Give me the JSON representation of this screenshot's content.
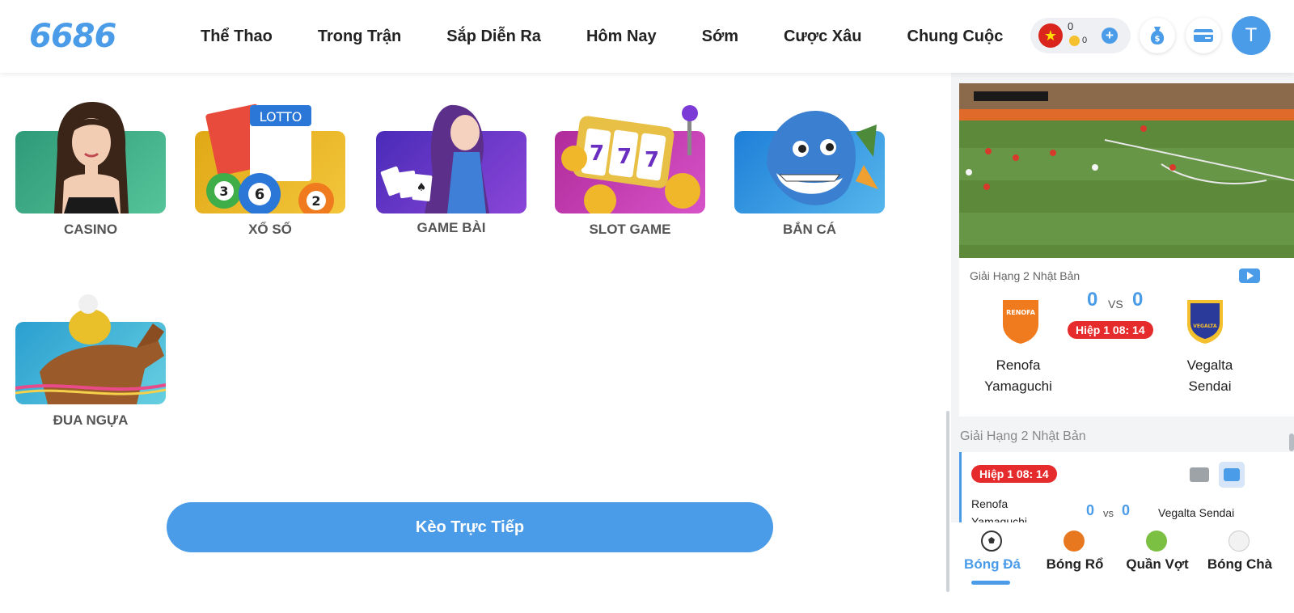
{
  "header": {
    "logo": "6686",
    "nav": [
      "Thể Thao",
      "Trong Trận",
      "Sắp Diễn Ra",
      "Hôm Nay",
      "Sớm",
      "Cược Xâu",
      "Chung Cuộc"
    ],
    "balance": "0",
    "coin_balance": "0",
    "avatar_letter": "T"
  },
  "games": [
    {
      "label": "CASINO"
    },
    {
      "label": "XỔ SỐ"
    },
    {
      "label": "GAME BÀI"
    },
    {
      "label": "SLOT GAME"
    },
    {
      "label": "BẮN CÁ"
    },
    {
      "label": "ĐUA NGỰA"
    }
  ],
  "live_button": "Kèo Trực Tiếp",
  "sidebar": {
    "featured": {
      "league": "Giải Hạng 2 Nhật Bản",
      "home_team": [
        "Renofa",
        "Yamaguchi"
      ],
      "away_team": [
        "Vegalta",
        "Sendai"
      ],
      "home_score": "0",
      "away_score": "0",
      "vs": "VS",
      "status": "Hiệp 1   08: 14",
      "home_logo_text": "RENOFA",
      "away_logo_text": "VEGALTA"
    },
    "section_title": "Giải Hạng 2 Nhật Bản",
    "list_match": {
      "status": "Hiệp 1   08: 14",
      "home_line1": "Renofa",
      "home_line2": "Yamaguchi",
      "away": "Vegalta Sendai",
      "home_score": "0",
      "away_score": "0",
      "vs": "vs"
    },
    "tabs": [
      {
        "label": "Bóng Đá",
        "icon": "soccer-ball-icon",
        "color": "#333333"
      },
      {
        "label": "Bóng Rổ",
        "icon": "basketball-icon",
        "color": "#e8781f"
      },
      {
        "label": "Quần Vợt",
        "icon": "tennis-ball-icon",
        "color": "#7bc043"
      },
      {
        "label": "Bóng Chà",
        "icon": "baseball-icon",
        "color": "#e6e6e6"
      }
    ]
  },
  "colors": {
    "accent": "#4a9be8",
    "live_badge": "#e52b2b"
  }
}
